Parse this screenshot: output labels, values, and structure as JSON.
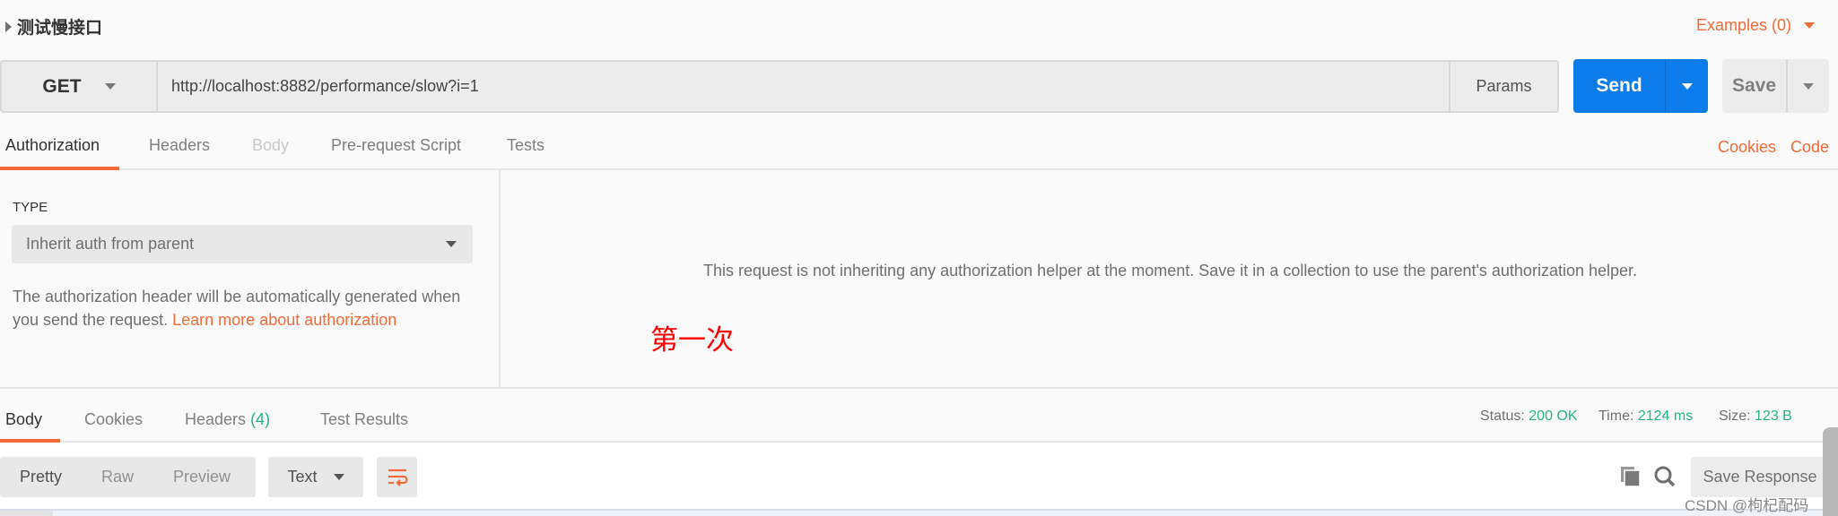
{
  "request": {
    "name": "测试慢接口",
    "examples": "Examples (0)",
    "method": "GET",
    "url": "http://localhost:8882/performance/slow?i=1",
    "params": "Params",
    "send": "Send",
    "save": "Save"
  },
  "tabs": [
    {
      "label": "Authorization",
      "state": "active"
    },
    {
      "label": "Headers",
      "state": "normal"
    },
    {
      "label": "Body",
      "state": "disabled"
    },
    {
      "label": "Pre-request Script",
      "state": "normal"
    },
    {
      "label": "Tests",
      "state": "normal"
    }
  ],
  "links": {
    "cookies": "Cookies",
    "code": "Code"
  },
  "auth": {
    "type_label": "TYPE",
    "type_value": "Inherit auth from parent",
    "desc": "The authorization header will be automatically generated when you send the request.",
    "learn_more": "Learn more about authorization",
    "message": "This request is not inheriting any authorization helper at the moment. Save it in a collection to use the parent's authorization helper."
  },
  "annotation": "第一次",
  "response": {
    "tabs": [
      "Body",
      "Cookies",
      "Headers",
      "Test Results"
    ],
    "headers_count": "(4)",
    "status_label": "Status:",
    "status": "200 OK",
    "time_label": "Time:",
    "time": "2124 ms",
    "size_label": "Size:",
    "size": "123 B",
    "views": [
      "Pretty",
      "Raw",
      "Preview"
    ],
    "format": "Text",
    "save_response": "Save Response"
  },
  "watermark": "CSDN @枸杞配码",
  "colors": {
    "accent": "#f26b3a",
    "send": "#0c7ceb",
    "success": "#26b47f"
  }
}
